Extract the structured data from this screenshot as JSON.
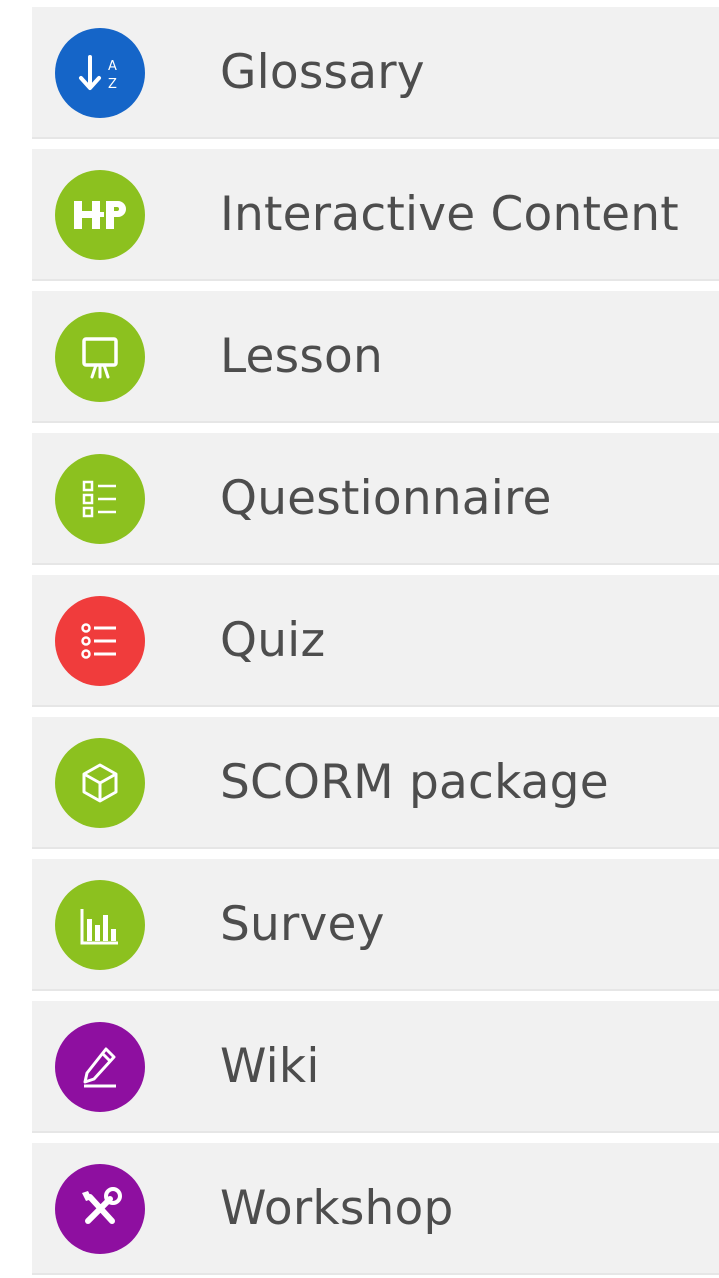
{
  "activity_chooser": {
    "items": [
      {
        "label": "Glossary",
        "icon": "glossary-az-icon",
        "color": "#1565c8"
      },
      {
        "label": "Interactive Content",
        "icon": "h5p-icon",
        "color": "#8cc11f"
      },
      {
        "label": "Lesson",
        "icon": "lesson-easel-icon",
        "color": "#8cc11f"
      },
      {
        "label": "Questionnaire",
        "icon": "questionnaire-icon",
        "color": "#8cc11f"
      },
      {
        "label": "Quiz",
        "icon": "quiz-list-icon",
        "color": "#f03c3c"
      },
      {
        "label": "SCORM package",
        "icon": "scorm-box-icon",
        "color": "#8cc11f"
      },
      {
        "label": "Survey",
        "icon": "survey-chart-icon",
        "color": "#8cc11f"
      },
      {
        "label": "Wiki",
        "icon": "wiki-pencil-icon",
        "color": "#8e0fa0"
      },
      {
        "label": "Workshop",
        "icon": "workshop-tools-icon",
        "color": "#8e0fa0"
      }
    ]
  }
}
